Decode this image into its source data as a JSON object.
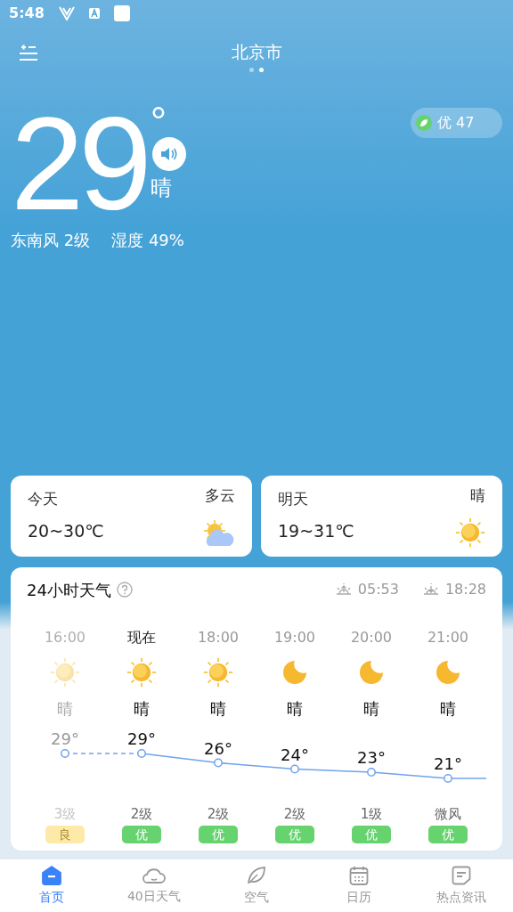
{
  "status_bar": {
    "time": "5:48"
  },
  "header": {
    "city": "北京市",
    "pages": [
      {
        "selected": false
      },
      {
        "selected": true
      }
    ]
  },
  "current": {
    "temperature": "29",
    "degree": "°",
    "condition": "晴",
    "wind": "东南风 2级",
    "humidity": "湿度 49%",
    "aqi": {
      "label": "优 47",
      "color": "#66d36e"
    }
  },
  "days": [
    {
      "label": "今天",
      "condition": "多云",
      "range": "20~30℃",
      "kind": "partly-cloudy"
    },
    {
      "label": "明天",
      "condition": "晴",
      "range": "19~31℃",
      "kind": "sun"
    }
  ],
  "hourly": {
    "title": "24小时天气",
    "sunrise": "05:53",
    "sunset": "18:28",
    "hours": [
      {
        "time": "16:00",
        "kind": "sun",
        "condition": "晴",
        "temp": "29°",
        "wind": "3级",
        "aqi": "良",
        "color": "#fdeaa8",
        "past": true,
        "now": false
      },
      {
        "time": "现在",
        "kind": "sun",
        "condition": "晴",
        "temp": "29°",
        "wind": "2级",
        "aqi": "优",
        "color": "#66d36e",
        "past": false,
        "now": true
      },
      {
        "time": "18:00",
        "kind": "sun",
        "condition": "晴",
        "temp": "26°",
        "wind": "2级",
        "aqi": "优",
        "color": "#66d36e",
        "past": false,
        "now": false
      },
      {
        "time": "19:00",
        "kind": "moon",
        "condition": "晴",
        "temp": "24°",
        "wind": "2级",
        "aqi": "优",
        "color": "#66d36e",
        "past": false,
        "now": false
      },
      {
        "time": "20:00",
        "kind": "moon",
        "condition": "晴",
        "temp": "23°",
        "wind": "1级",
        "aqi": "优",
        "color": "#66d36e",
        "past": false,
        "now": false
      },
      {
        "time": "21:00",
        "kind": "moon",
        "condition": "晴",
        "temp": "21°",
        "wind": "微风",
        "aqi": "优",
        "color": "#66d36e",
        "past": false,
        "now": false
      }
    ]
  },
  "nav": [
    {
      "label": "首页",
      "kind": "home",
      "selected": true
    },
    {
      "label": "40日天气",
      "kind": "cloud",
      "selected": false
    },
    {
      "label": "空气",
      "kind": "leaf",
      "selected": false
    },
    {
      "label": "日历",
      "kind": "calendar",
      "selected": false
    },
    {
      "label": "热点资讯",
      "kind": "news",
      "selected": false
    }
  ]
}
